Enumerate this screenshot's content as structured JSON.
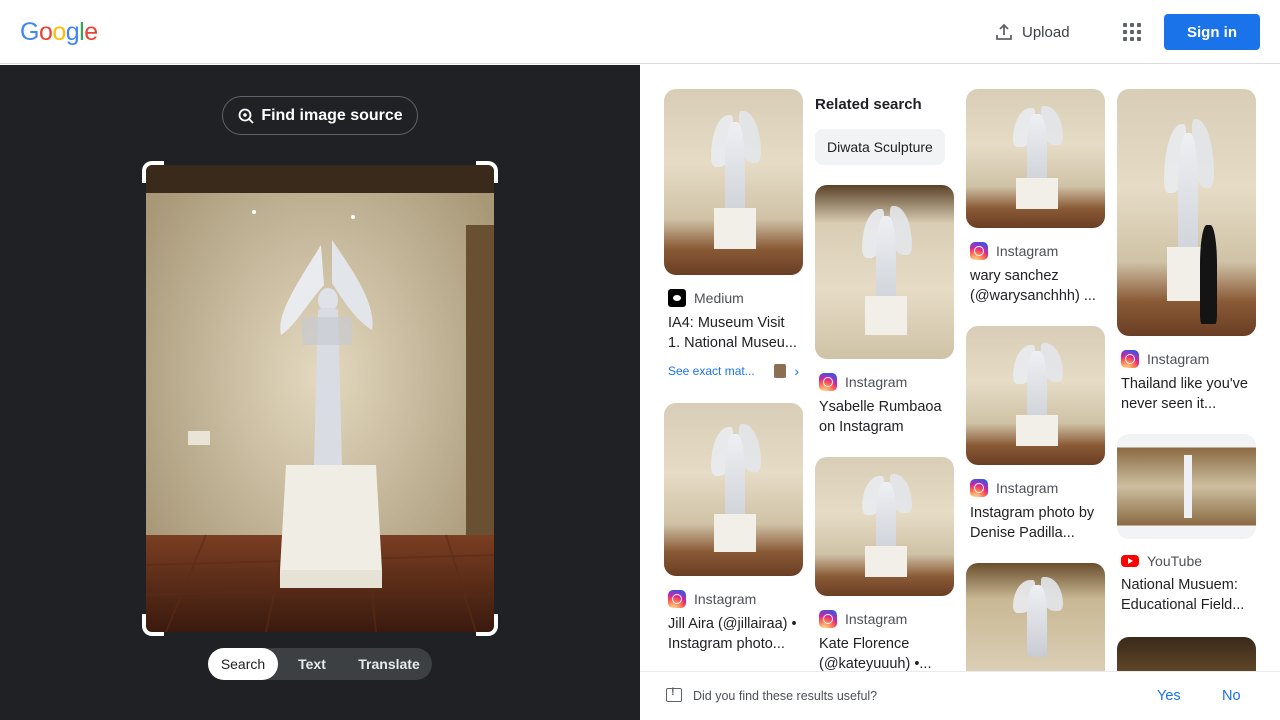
{
  "header": {
    "logo_letters": [
      {
        "ch": "G",
        "color": "#4285f4"
      },
      {
        "ch": "o",
        "color": "#ea4335"
      },
      {
        "ch": "o",
        "color": "#fbbc05"
      },
      {
        "ch": "g",
        "color": "#4285f4"
      },
      {
        "ch": "l",
        "color": "#34a853"
      },
      {
        "ch": "e",
        "color": "#ea4335"
      }
    ],
    "upload_label": "Upload",
    "apps_icon": "apps-grid-icon",
    "signin_label": "Sign in",
    "accent_color": "#1a73e8"
  },
  "lens": {
    "find_source_label": "Find image source",
    "modes": [
      "Search",
      "Text",
      "Translate"
    ],
    "active_mode": "Search"
  },
  "related": {
    "title": "Related search",
    "chip": "Diwata Sculpture"
  },
  "results": {
    "col1": [
      {
        "source": "Medium",
        "icon": "medium",
        "title": "IA4: Museum Visit 1. National Museu...",
        "exact_label": "See exact mat..."
      },
      {
        "source": "Instagram",
        "icon": "instagram",
        "title": "Jill Aira (@jillairaa) • Instagram photo..."
      }
    ],
    "col2": [
      {
        "source": "Instagram",
        "icon": "instagram",
        "title": "Ysabelle Rumbaoa on Instagram"
      },
      {
        "source": "Instagram",
        "icon": "instagram",
        "title": "Kate Florence (@kateyuuuh) •..."
      }
    ],
    "col3": [
      {
        "source": "Instagram",
        "icon": "instagram",
        "title": "wary sanchez (@warysanchhh) ..."
      },
      {
        "source": "Instagram",
        "icon": "instagram",
        "title": "Instagram photo by Denise Padilla..."
      }
    ],
    "col4": [
      {
        "source": "Instagram",
        "icon": "instagram",
        "title": "Thailand like you've never seen it..."
      },
      {
        "source": "YouTube",
        "icon": "youtube",
        "title": "National Musuem: Educational Field..."
      }
    ]
  },
  "feedback": {
    "question": "Did you find these results useful?",
    "yes": "Yes",
    "no": "No"
  }
}
